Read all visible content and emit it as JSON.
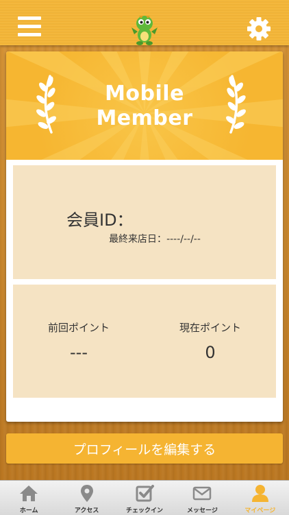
{
  "colors": {
    "accent": "#f5b432",
    "panel": "#f5e3c3",
    "wood": "#c98a2c",
    "tab_icon": "#8a8a8a"
  },
  "header": {
    "menu_icon": "hamburger-icon",
    "settings_icon": "gear-icon",
    "logo_icon": "dragon-mascot-logo"
  },
  "banner": {
    "title_line1": "Mobile",
    "title_line2": "Member"
  },
  "member": {
    "id_label": "会員ID：",
    "last_visit_label": "最終来店日：",
    "last_visit_value": "----/--/--"
  },
  "points": {
    "previous_label": "前回ポイント",
    "previous_value": "---",
    "current_label": "現在ポイント",
    "current_value": "0"
  },
  "edit_profile_label": "プロフィールを編集する",
  "tabs": [
    {
      "label": "ホーム",
      "icon": "home-icon",
      "active": false
    },
    {
      "label": "アクセス",
      "icon": "location-pin-icon",
      "active": false
    },
    {
      "label": "チェックイン",
      "icon": "checkin-icon",
      "active": false
    },
    {
      "label": "メッセージ",
      "icon": "mail-icon",
      "active": false
    },
    {
      "label": "マイページ",
      "icon": "person-icon",
      "active": true
    }
  ]
}
